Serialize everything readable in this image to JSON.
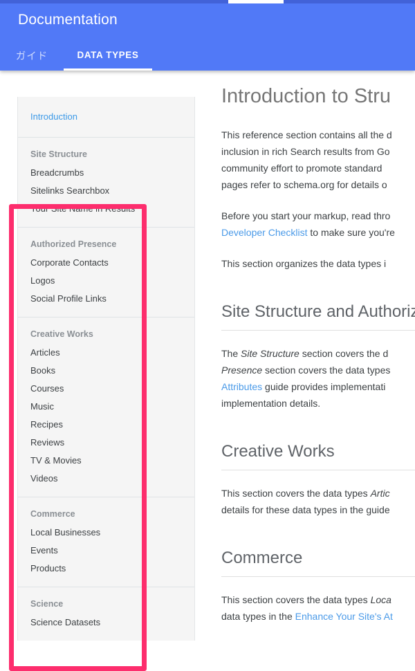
{
  "colors": {
    "header_blue": "#5179f7",
    "top_strip_blue": "#4262d8",
    "highlight_pink": "#fd2d6d",
    "link_blue": "#3d9ae8",
    "sidebar_bg": "#f5f5f5"
  },
  "header": {
    "title": "Documentation",
    "tabs": [
      {
        "label": "ガイド",
        "active": false
      },
      {
        "label": "DATA TYPES",
        "active": true
      }
    ]
  },
  "sidebar": {
    "intro_link": "Introduction",
    "groups": [
      {
        "heading": "Site Structure",
        "items": [
          "Breadcrumbs",
          "Sitelinks Searchbox",
          "Your Site Name in Results"
        ]
      },
      {
        "heading": "Authorized Presence",
        "items": [
          "Corporate Contacts",
          "Logos",
          "Social Profile Links"
        ]
      },
      {
        "heading": "Creative Works",
        "items": [
          "Articles",
          "Books",
          "Courses",
          "Music",
          "Recipes",
          "Reviews",
          "TV & Movies",
          "Videos"
        ]
      },
      {
        "heading": "Commerce",
        "items": [
          "Local Businesses",
          "Events",
          "Products"
        ]
      },
      {
        "heading": "Science",
        "items": [
          "Science Datasets"
        ]
      }
    ]
  },
  "main": {
    "title": "Introduction to Stru",
    "para1_line1": "This reference section contains all the d",
    "para1_line2": "inclusion in rich Search results from Go",
    "para1_line3": "community effort to promote standard ",
    "para1_line4": "pages refer to schema.org for details o",
    "para2_prefix": "Before you start your markup, read thro",
    "para2_link": "Developer Checklist",
    "para2_suffix": " to make sure you're",
    "para3": "This section organizes the data types i",
    "heading_site_structure": "Site Structure and Authorize",
    "para4_a": "The ",
    "para4_em1": "Site Structure",
    "para4_b": " section covers the d",
    "para4_em2": "Presence",
    "para4_c": " section covers the data types",
    "para4_link": "Attributes",
    "para4_d": " guide provides implementati",
    "para4_e": "implementation details.",
    "heading_creative_works": "Creative Works",
    "para5_a": "This section covers the data types ",
    "para5_em": "Artic",
    "para5_b": "details for these data types in the guide",
    "heading_commerce": "Commerce",
    "para6_a": "This section covers the data types ",
    "para6_em": "Loca",
    "para6_b": "data types in the ",
    "para6_link": "Enhance Your Site's At"
  }
}
